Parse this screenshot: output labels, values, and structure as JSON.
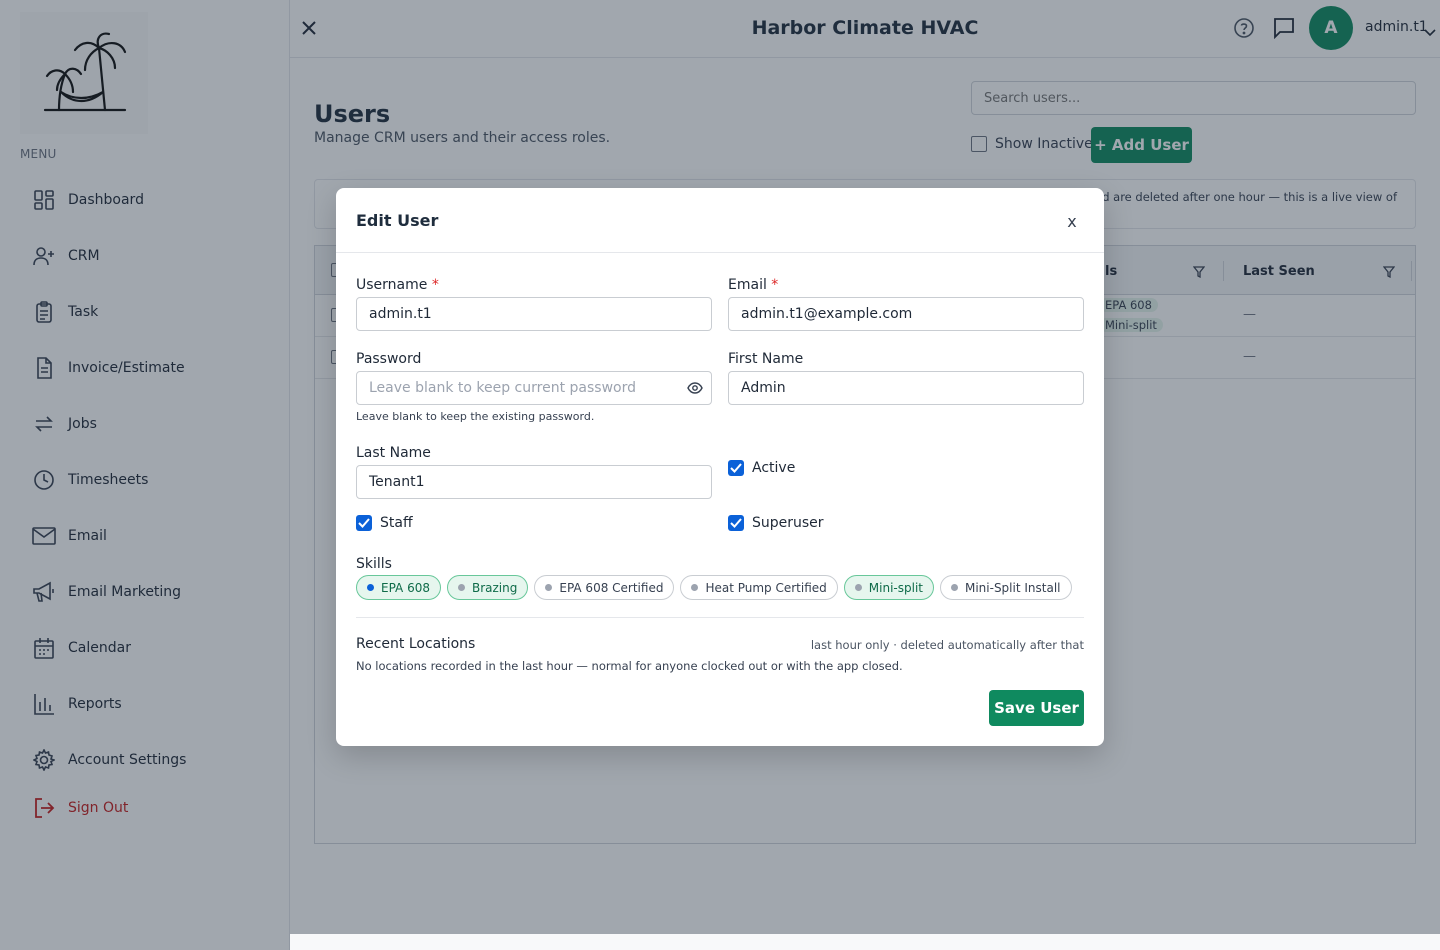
{
  "sidebar": {
    "menu_label": "MENU",
    "items": [
      {
        "label": "Dashboard",
        "icon": "dashboard-icon"
      },
      {
        "label": "CRM",
        "icon": "user-plus-icon"
      },
      {
        "label": "Task",
        "icon": "clipboard-icon"
      },
      {
        "label": "Invoice/Estimate",
        "icon": "document-icon"
      },
      {
        "label": "Jobs",
        "icon": "repeat-icon"
      },
      {
        "label": "Timesheets",
        "icon": "clock-icon"
      },
      {
        "label": "Email",
        "icon": "mail-icon"
      },
      {
        "label": "Email Marketing",
        "icon": "megaphone-icon"
      },
      {
        "label": "Calendar",
        "icon": "calendar-icon"
      },
      {
        "label": "Reports",
        "icon": "bar-chart-icon"
      },
      {
        "label": "Account Settings",
        "icon": "gear-icon"
      }
    ],
    "sign_out": "Sign Out"
  },
  "topbar": {
    "title": "Harbor Climate HVAC",
    "avatar_initial": "A",
    "user_name": "admin.t1"
  },
  "page": {
    "title": "Users",
    "subtitle": "Manage CRM users and their access roles.",
    "search_placeholder": "Search users...",
    "show_inactive_label": "Show Inactive",
    "add_user_label": "+ Add User",
    "banner_text": "en, and are deleted after one hour — this is a live view of",
    "table": {
      "headers": {
        "skills": "ls",
        "last_seen": "Last Seen"
      },
      "rows": [
        {
          "skills": [
            "EPA 608",
            "Mini-split"
          ],
          "last_seen": "—"
        },
        {
          "skills": [],
          "last_seen": "—"
        }
      ]
    }
  },
  "modal": {
    "title": "Edit User",
    "close_label": "x",
    "username": {
      "label": "Username",
      "required": "*",
      "value": "admin.t1"
    },
    "email": {
      "label": "Email",
      "required": "*",
      "value": "admin.t1@example.com"
    },
    "password": {
      "label": "Password",
      "placeholder": "Leave blank to keep current password",
      "help": "Leave blank to keep the existing password."
    },
    "first_name": {
      "label": "First Name",
      "value": "Admin"
    },
    "last_name": {
      "label": "Last Name",
      "value": "Tenant1"
    },
    "active": {
      "label": "Active",
      "checked": true
    },
    "staff": {
      "label": "Staff",
      "checked": true
    },
    "superuser": {
      "label": "Superuser",
      "checked": true
    },
    "skills_label": "Skills",
    "skills": [
      {
        "label": "EPA 608",
        "selected": true
      },
      {
        "label": "Brazing",
        "selected": true
      },
      {
        "label": "EPA 608 Certified",
        "selected": false
      },
      {
        "label": "Heat Pump Certified",
        "selected": false
      },
      {
        "label": "Mini-split",
        "selected": true
      },
      {
        "label": "Mini-Split Install",
        "selected": false
      }
    ],
    "recent_locations": {
      "title": "Recent Locations",
      "note": "last hour only · deleted automatically after that",
      "empty": "No locations recorded in the last hour — normal for anyone clocked out or with the app closed."
    },
    "save_label": "Save User"
  },
  "colors": {
    "accent": "#0f8a5f",
    "checkbox": "#0b61d8",
    "required": "#dc2626",
    "sign_out": "#c81e1e"
  }
}
